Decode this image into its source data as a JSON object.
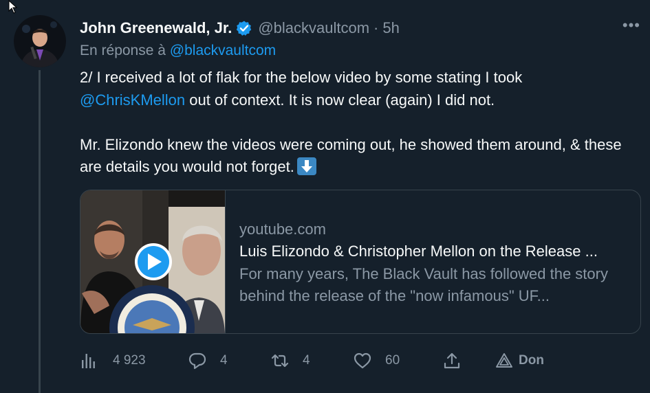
{
  "author": {
    "display_name": "John Greenewald, Jr.",
    "handle": "@blackvaultcom",
    "separator": "·",
    "time": "5h"
  },
  "reply": {
    "prefix": "En réponse à",
    "handle": "@blackvaultcom"
  },
  "tweet": {
    "line1": "2/ I received a lot of flak for the below video by some stating I took",
    "mention": "@ChrisKMellon",
    "line2": " out of context. It is now clear (again) I did not.",
    "para2": "Mr. Elizondo knew the videos were coming out, he showed them around, & these are details you would not forget."
  },
  "card": {
    "domain": "youtube.com",
    "title": "Luis Elizondo & Christopher Mellon on the Release ...",
    "description": "For many years, The Black Vault has followed the story behind the release of the \"now infamous\" UF..."
  },
  "actions": {
    "views": "4 923",
    "replies": "4",
    "retweets": "4",
    "likes": "60",
    "donate": "Don"
  },
  "colors": {
    "background": "#15202b",
    "accent": "#1d9bf0",
    "muted": "#8b98a5",
    "text": "#f7f9f9"
  }
}
